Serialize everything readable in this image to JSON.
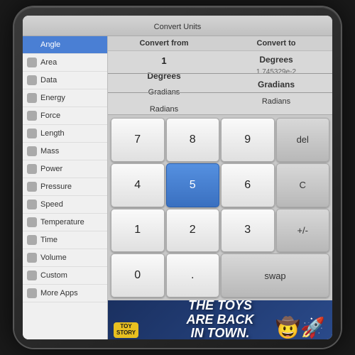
{
  "titleBar": {
    "label": "Convert Units"
  },
  "sidebar": {
    "items": [
      {
        "id": "angle",
        "label": "Angle",
        "active": true
      },
      {
        "id": "area",
        "label": "Area",
        "active": false
      },
      {
        "id": "data",
        "label": "Data",
        "active": false
      },
      {
        "id": "energy",
        "label": "Energy",
        "active": false
      },
      {
        "id": "force",
        "label": "Force",
        "active": false
      },
      {
        "id": "length",
        "label": "Length",
        "active": false
      },
      {
        "id": "mass",
        "label": "Mass",
        "active": false
      },
      {
        "id": "power",
        "label": "Power",
        "active": false
      },
      {
        "id": "pressure",
        "label": "Pressure",
        "active": false
      },
      {
        "id": "speed",
        "label": "Speed",
        "active": false
      },
      {
        "id": "temperature",
        "label": "Temperature",
        "active": false
      },
      {
        "id": "time",
        "label": "Time",
        "active": false
      },
      {
        "id": "volume",
        "label": "Volume",
        "active": false
      },
      {
        "id": "custom",
        "label": "Custom",
        "active": false
      },
      {
        "id": "more-apps",
        "label": "More Apps",
        "active": false
      }
    ]
  },
  "converter": {
    "fromHeader": "Convert from",
    "toHeader": "Convert to",
    "fromValue": "1",
    "fromUnit": "Degrees",
    "fromUnits": [
      "Degrees",
      "Gradians",
      "Radians"
    ],
    "toValue": "1.745329e-2",
    "toUnit": "Gradians",
    "toUnits": [
      "Degrees",
      "Gradians",
      "Radians"
    ]
  },
  "numpad": {
    "buttons": [
      {
        "label": "7",
        "type": "number"
      },
      {
        "label": "8",
        "type": "number"
      },
      {
        "label": "9",
        "type": "number"
      },
      {
        "label": "del",
        "type": "action"
      },
      {
        "label": "4",
        "type": "number"
      },
      {
        "label": "5",
        "type": "number",
        "active": true
      },
      {
        "label": "6",
        "type": "number"
      },
      {
        "label": "C",
        "type": "action"
      },
      {
        "label": "1",
        "type": "number"
      },
      {
        "label": "2",
        "type": "number"
      },
      {
        "label": "3",
        "type": "number"
      },
      {
        "label": "+/-",
        "type": "action"
      },
      {
        "label": "0",
        "type": "number"
      },
      {
        "label": ".",
        "type": "number"
      },
      {
        "label": "swap",
        "type": "action"
      }
    ]
  },
  "ad": {
    "text": "THE TOYS\nARE BACK\nIN TOWN.",
    "badge": "TOY\nSTORY"
  }
}
